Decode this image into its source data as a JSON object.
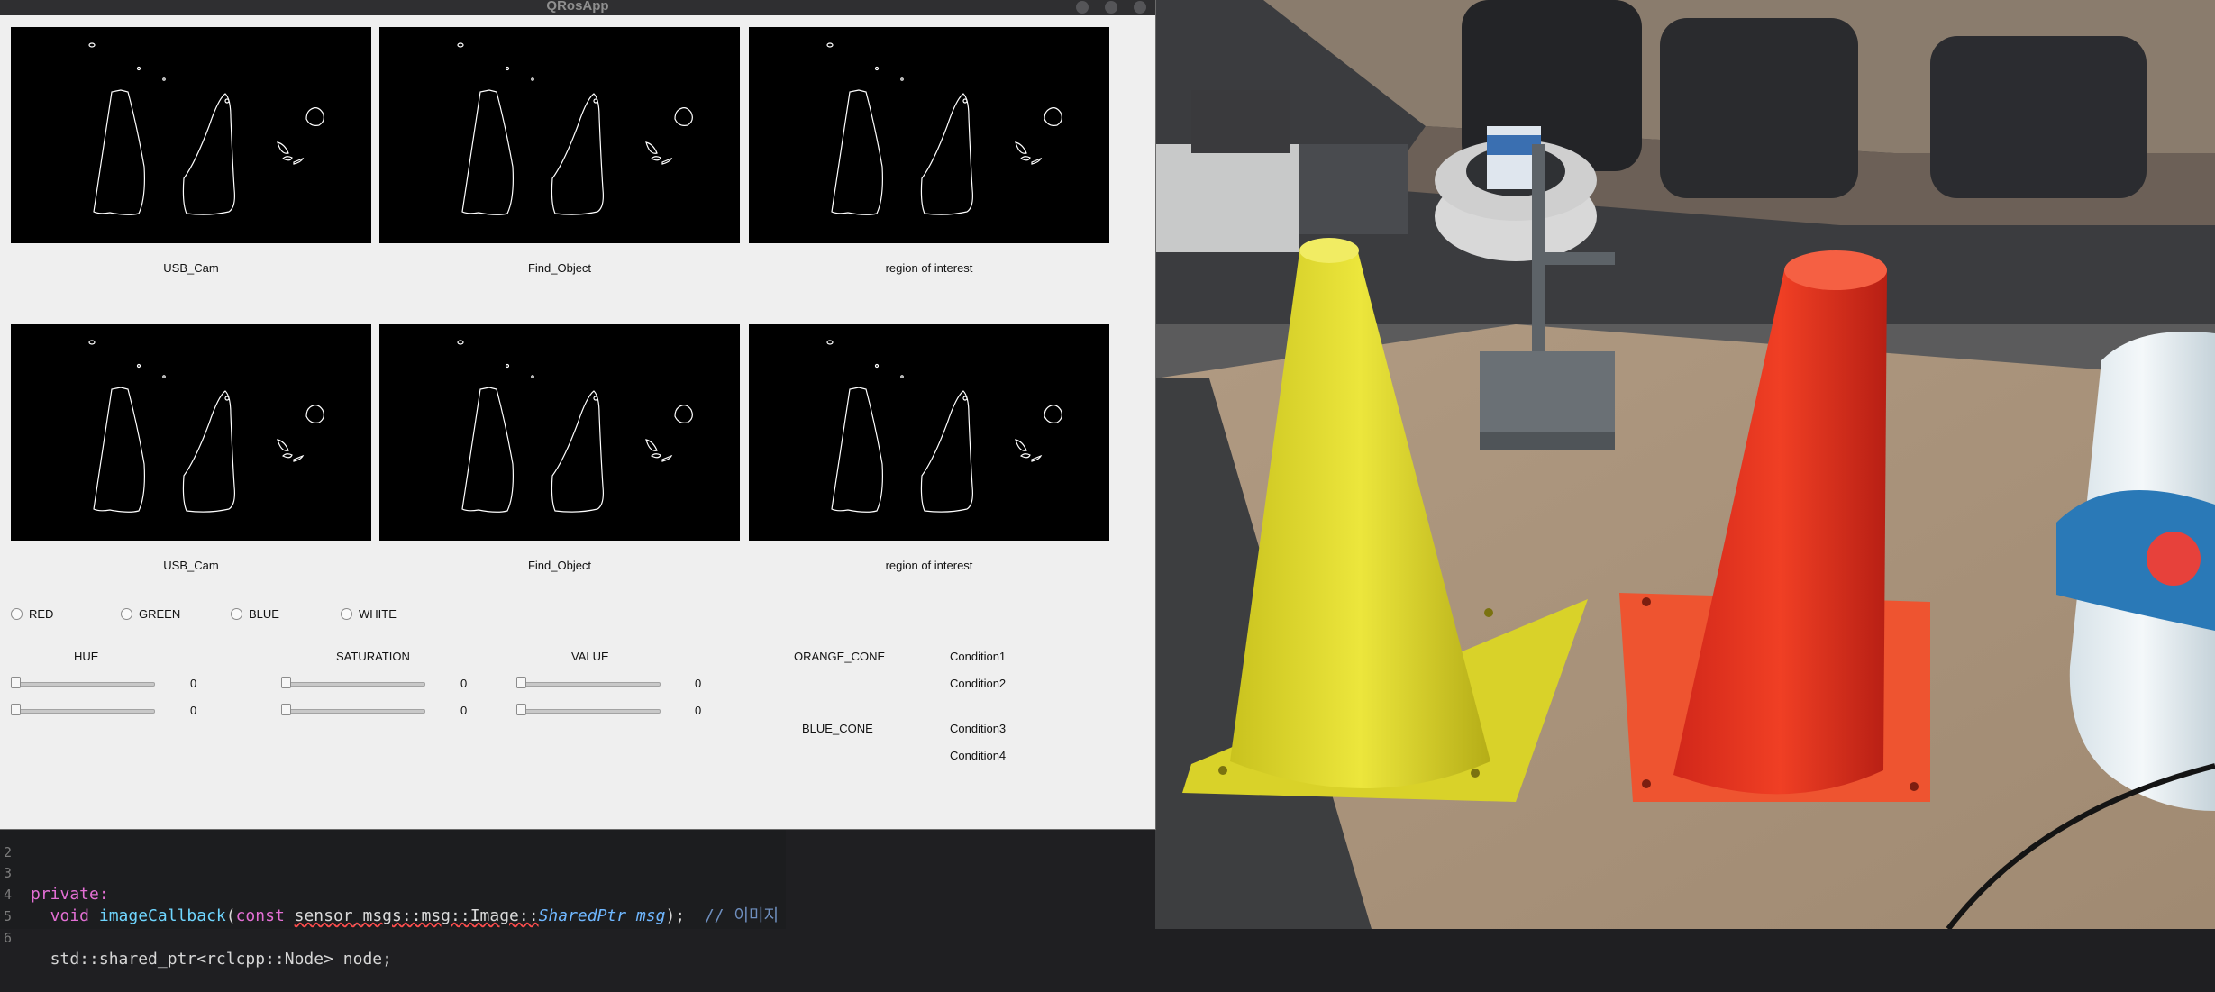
{
  "window": {
    "title": "QRosApp"
  },
  "panes": [
    {
      "label": "USB_Cam"
    },
    {
      "label": "Find_Object"
    },
    {
      "label": "region of interest"
    },
    {
      "label": "USB_Cam"
    },
    {
      "label": "Find_Object"
    },
    {
      "label": "region of interest"
    }
  ],
  "colors": [
    {
      "label": "RED"
    },
    {
      "label": "GREEN"
    },
    {
      "label": "BLUE"
    },
    {
      "label": "WHITE"
    }
  ],
  "controls": {
    "hue_label": "HUE",
    "saturation_label": "SATURATION",
    "value_label": "VALUE",
    "rows": [
      {
        "hue": "0",
        "saturation": "0",
        "value": "0"
      },
      {
        "hue": "0",
        "saturation": "0",
        "value": "0"
      }
    ]
  },
  "conditions": {
    "orange_label": "ORANGE_CONE",
    "blue_label": "BLUE_CONE",
    "items": [
      "Condition1",
      "Condition2",
      "Condition3",
      "Condition4"
    ]
  },
  "editor": {
    "lines": [
      {
        "num": "2",
        "text": ""
      },
      {
        "num": "3",
        "text": "private:"
      },
      {
        "num": "4",
        "pre": "  void ",
        "fn": "imageCallback",
        "mid": "(",
        "kw": "const ",
        "ty": "sensor_msgs::msg::Image::",
        "it": "SharedPtr msg",
        "end": ");  ",
        "cm": "// 이미지"
      },
      {
        "num": "5",
        "text": ""
      },
      {
        "num": "6",
        "text": "  std::shared_ptr<rclcpp::Node> node;"
      }
    ]
  },
  "accent_colors": {
    "cone_yellow": "#e6e23a",
    "cone_red": "#e8341f",
    "window_bg": "#efefef"
  }
}
